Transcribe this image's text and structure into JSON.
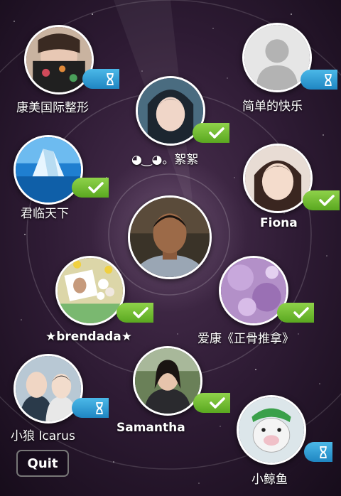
{
  "friends": [
    {
      "id": "kangmei",
      "name": "康美国际整形",
      "status": "pending"
    },
    {
      "id": "jiandan",
      "name": "简单的快乐",
      "status": "pending"
    },
    {
      "id": "xuxu",
      "name": "◕‿◕。絮絮",
      "status": "accepted"
    },
    {
      "id": "junlin",
      "name": "君临天下",
      "status": "accepted"
    },
    {
      "id": "fiona",
      "name": "Fiona",
      "status": "accepted"
    },
    {
      "id": "brendada",
      "name": "★brendada★",
      "status": "accepted"
    },
    {
      "id": "aikang",
      "name": "爱康《正骨推拿》",
      "status": "accepted"
    },
    {
      "id": "xiaolang",
      "name": "小狼 Icarus",
      "status": "pending"
    },
    {
      "id": "samantha",
      "name": "Samantha",
      "status": "accepted"
    },
    {
      "id": "xiaojingyu",
      "name": "小鲸鱼",
      "status": "pending"
    }
  ],
  "controls": {
    "quit_label": "Quit"
  },
  "colors": {
    "accepted_badge": "#6cbc2c",
    "pending_badge": "#2a96d0",
    "background": "#2b1a33"
  },
  "icons": {
    "accepted": "checkmark-icon",
    "pending": "hourglass-icon"
  }
}
